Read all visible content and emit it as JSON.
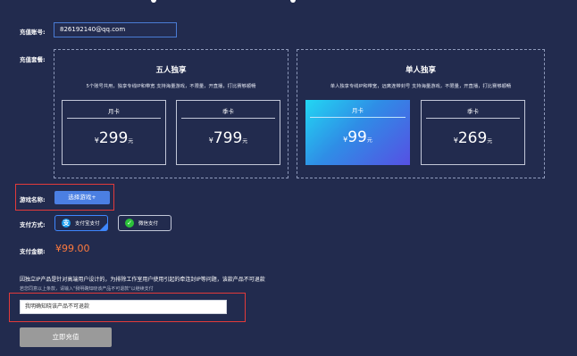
{
  "account": {
    "label": "充值账号:",
    "value": "826192140@qq.com"
  },
  "plans": {
    "label": "充值套餐:",
    "groups": [
      {
        "title": "五人独享",
        "desc": "5个账号共用，独享专线IP和带宽    支持海量游戏，不限量，开直播，打比赛够顺畅",
        "cards": [
          {
            "name": "月卡",
            "currency": "¥",
            "price": "299",
            "unit": "元",
            "selected": false
          },
          {
            "name": "季卡",
            "currency": "¥",
            "price": "799",
            "unit": "元",
            "selected": false
          }
        ]
      },
      {
        "title": "单人独享",
        "desc": "单人独享专线IP和带宽，远离连带封号 支持海量游戏，不限量，开直播，打比赛够顺畅",
        "cards": [
          {
            "name": "月卡",
            "currency": "¥",
            "price": "99",
            "unit": "元",
            "selected": true
          },
          {
            "name": "季卡",
            "currency": "¥",
            "price": "269",
            "unit": "元",
            "selected": false
          }
        ]
      }
    ]
  },
  "game": {
    "label": "游戏名称:",
    "button": "选择游戏+"
  },
  "payment": {
    "label": "支付方式:",
    "options": [
      {
        "name": "支付宝支付",
        "icon": "alipay-icon",
        "color": "#1a9ef0",
        "selected": true
      },
      {
        "name": "微信支付",
        "icon": "wechat-icon",
        "color": "#2cc13a",
        "selected": false
      }
    ]
  },
  "amount": {
    "label": "支付金额:",
    "value": "¥99.00"
  },
  "notice": {
    "text": "因独立IP产品是针对高端用户设计的，为排除工作室用户使用引起的牵连封IP等问题，该款产品不可退款",
    "sub": "若您同意以上条款，请输入\"我明确知晓该产品不可退款\"以继续支付"
  },
  "confirm_input": {
    "placeholder": "我明确知晓该产品不可退款"
  },
  "submit": {
    "label": "立即充值"
  },
  "colors": {
    "background": "#222b4e",
    "accent": "#4b7fe3",
    "price": "#ff7a3d",
    "highlight": "#e23a3a"
  }
}
